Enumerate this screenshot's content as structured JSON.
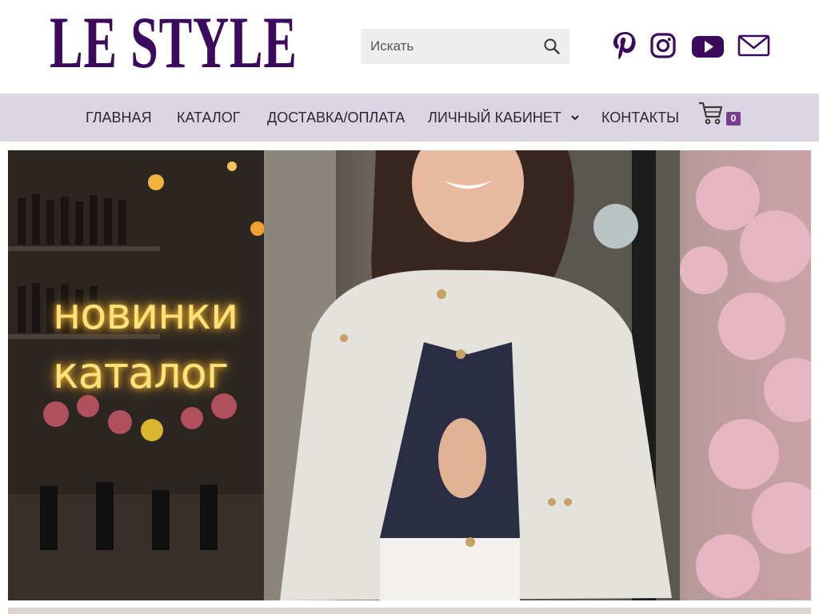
{
  "header": {
    "logo_text": "LE STYLE",
    "search": {
      "placeholder": "Искать"
    },
    "social_icons": [
      "pinterest-icon",
      "instagram-icon",
      "youtube-icon",
      "mail-icon"
    ]
  },
  "nav": {
    "items": [
      {
        "label": "ГЛАВНАЯ"
      },
      {
        "label": "КАТАЛОГ"
      },
      {
        "label": "ДОСТАВКА/ОПЛАТА"
      },
      {
        "label": "ЛИЧНЫЙ КАБИНЕТ",
        "has_dropdown": true
      },
      {
        "label": "КОНТАКТЫ"
      }
    ],
    "cart_count": "0"
  },
  "banner": {
    "line1": "новинки",
    "line2": "каталог"
  },
  "colors": {
    "brand": "#3b0a5c",
    "nav_bg": "#dcd6e4",
    "badge": "#7a3d92",
    "neon_text": "#fce27a"
  }
}
